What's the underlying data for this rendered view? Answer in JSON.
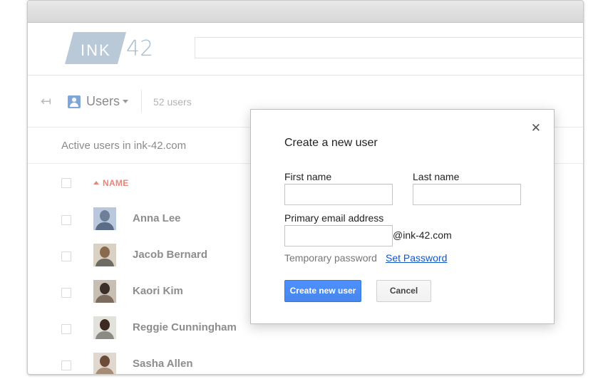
{
  "logo": {
    "text": "INK",
    "number": "42"
  },
  "search": {
    "placeholder": ""
  },
  "toolbar": {
    "section": "Users",
    "count": "52 users"
  },
  "list": {
    "heading": "Active users in ink-42.com",
    "column_name": "NAME",
    "users": [
      {
        "name": "Anna Lee"
      },
      {
        "name": "Jacob Bernard"
      },
      {
        "name": "Kaori Kim"
      },
      {
        "name": "Reggie Cunningham"
      },
      {
        "name": "Sasha Allen"
      }
    ]
  },
  "dialog": {
    "title": "Create a new user",
    "first_name_label": "First name",
    "last_name_label": "Last name",
    "email_label": "Primary email address",
    "email_domain": "@ink-42.com",
    "temp_password_label": "Temporary password",
    "set_password_link": "Set Password",
    "create_button": "Create new user",
    "cancel_button": "Cancel",
    "close_symbol": "✕"
  },
  "colors": {
    "primary_button": "#4d90fe",
    "link": "#1155cc",
    "sort_accent": "#e8867a",
    "logo": "#b9c9d8"
  }
}
